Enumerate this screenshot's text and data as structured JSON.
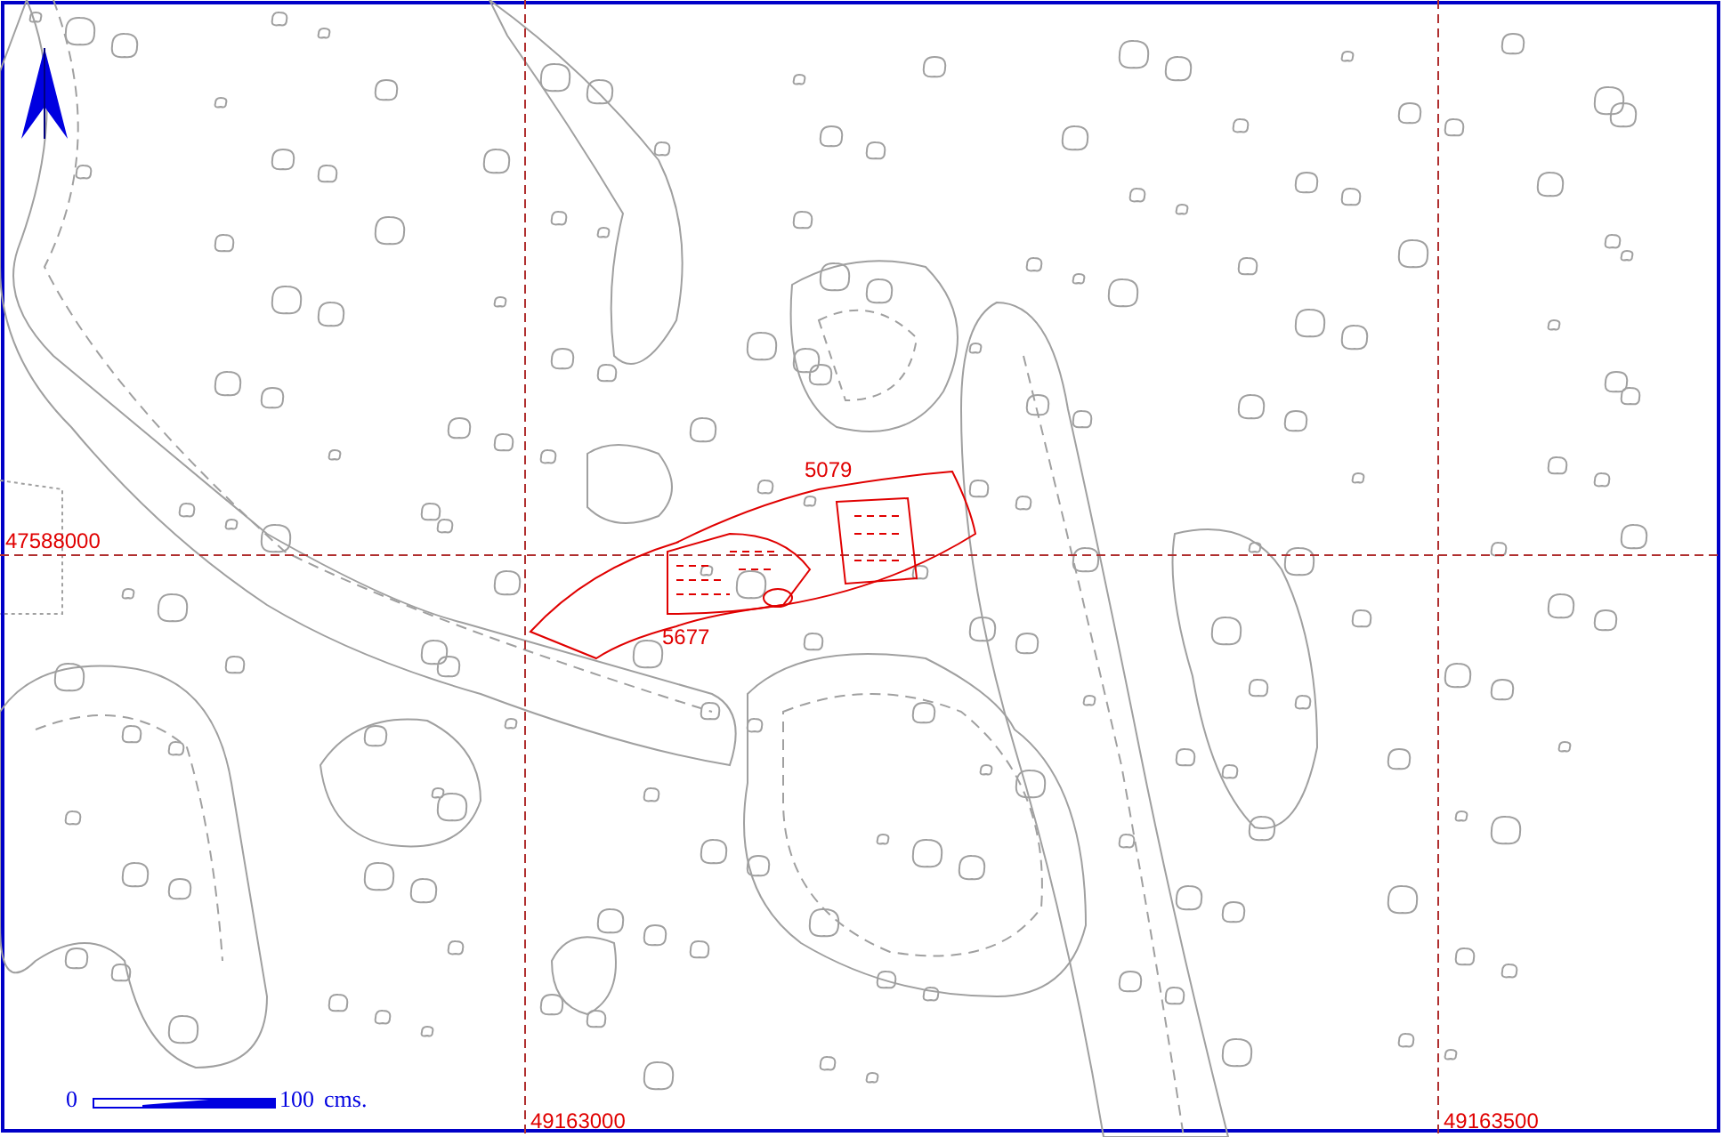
{
  "map": {
    "grid": {
      "y_labels": [
        "47588000"
      ],
      "x_labels": [
        "49163000",
        "49163500"
      ]
    },
    "features": [
      {
        "label": "5079"
      },
      {
        "label": "5677"
      }
    ],
    "scale_bar": {
      "start": "0",
      "end": "100",
      "unit": "cms."
    }
  }
}
